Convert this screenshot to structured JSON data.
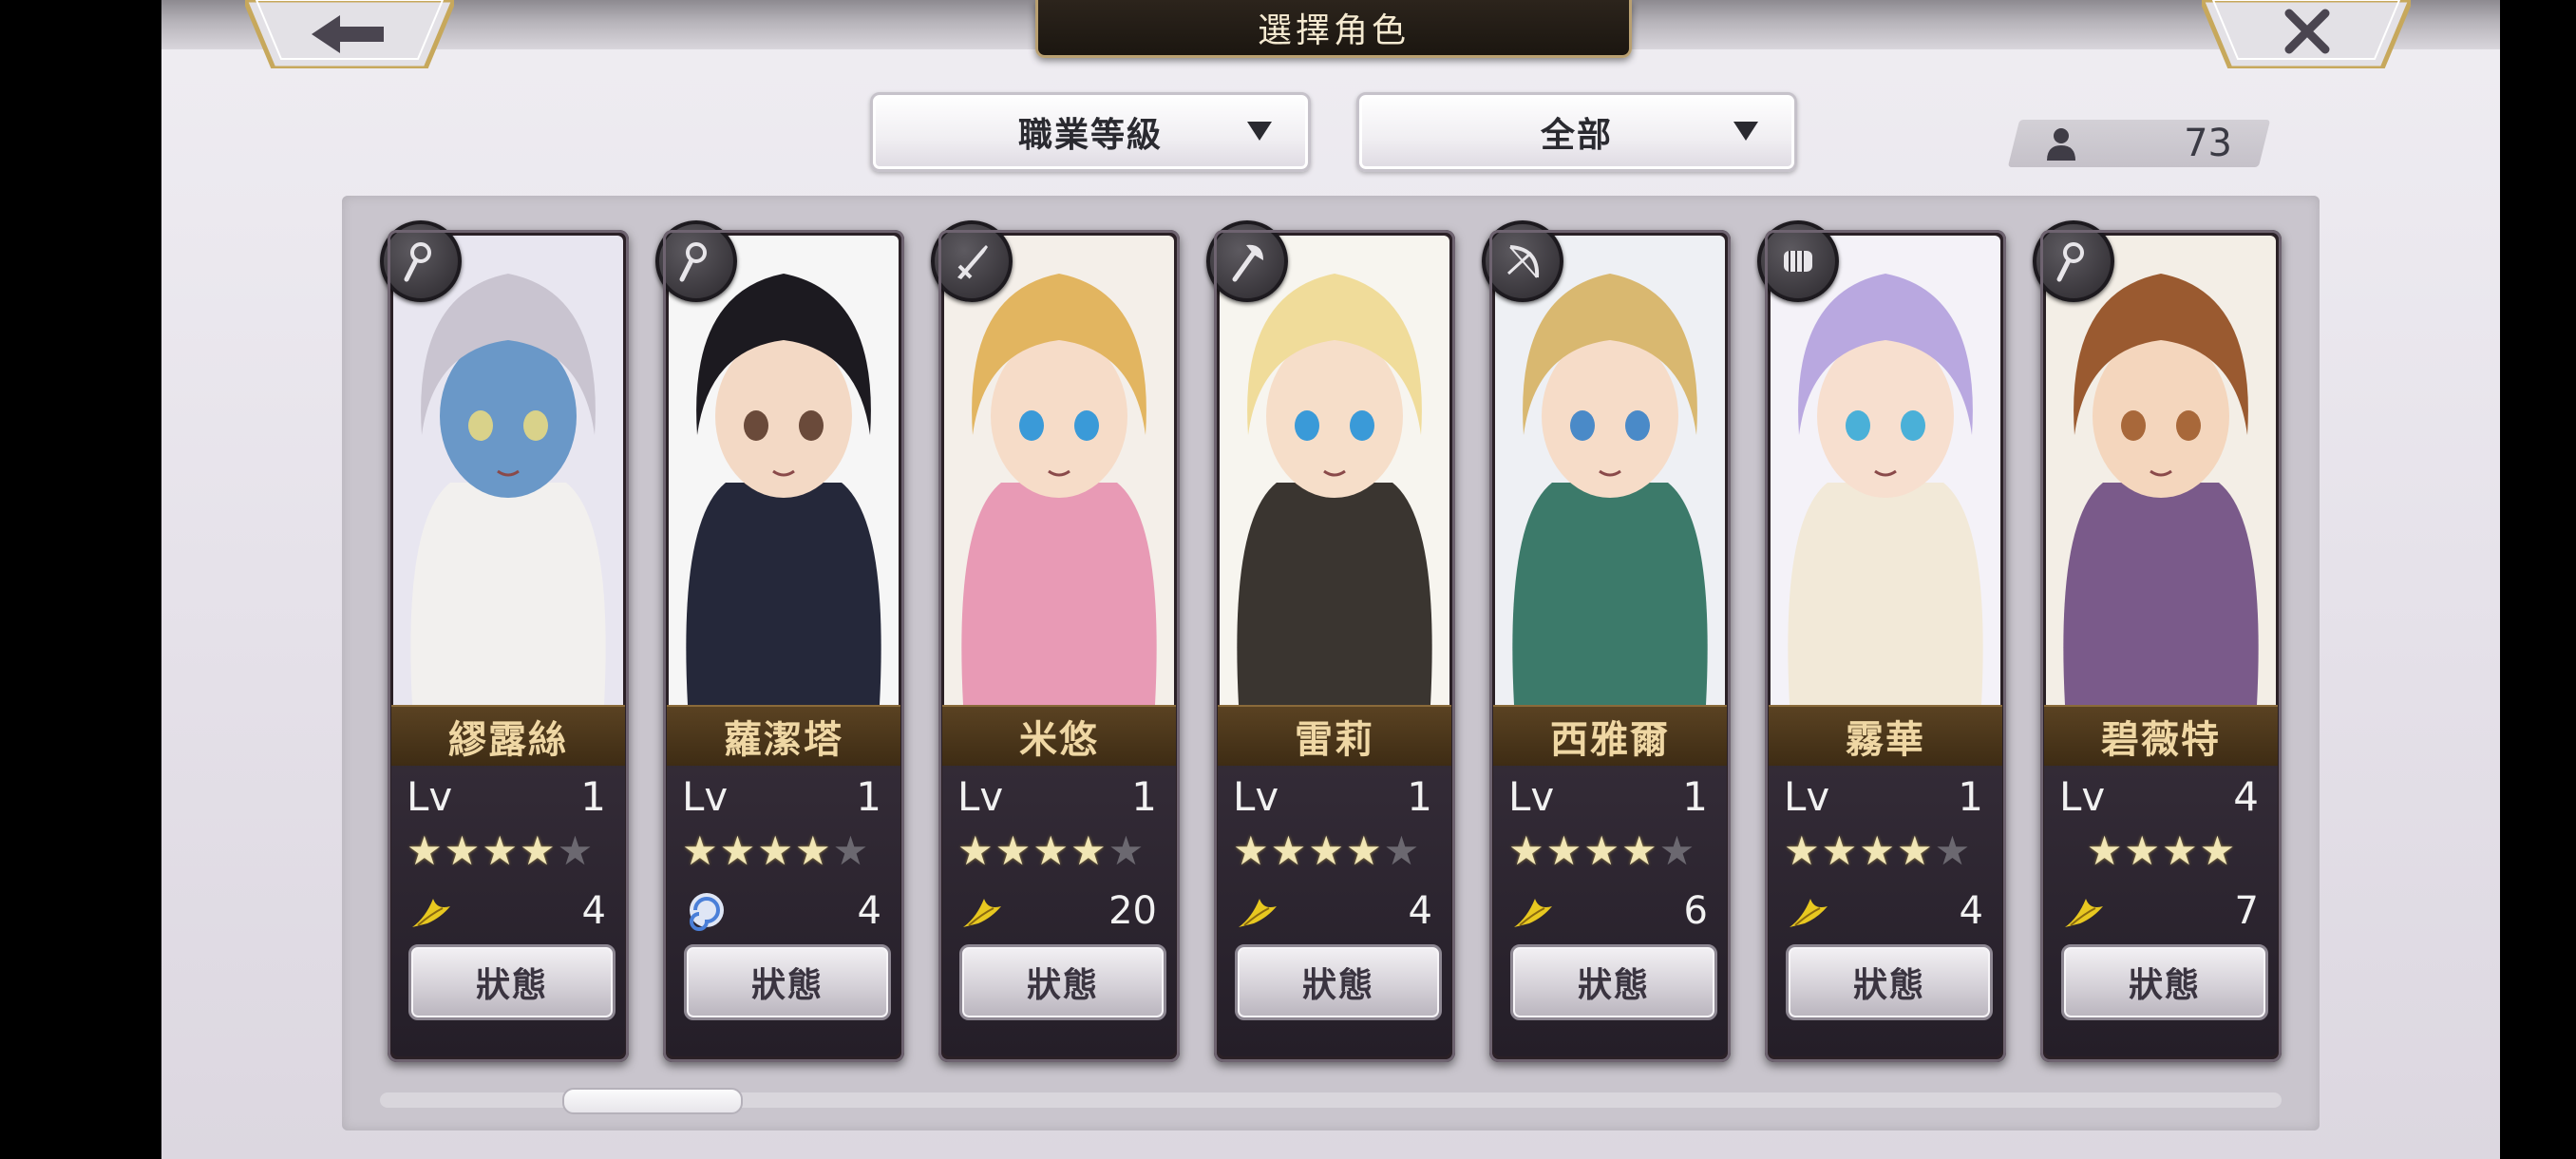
{
  "header": {
    "title": "選擇角色",
    "back_icon": "back-arrow-icon",
    "close_icon": "close-x-icon"
  },
  "filters": {
    "class_sort_label": "職業等級",
    "category_label": "全部"
  },
  "character_count": "73",
  "status_button_label": "狀態",
  "lv_label": "Lv",
  "characters": [
    {
      "name": "繆露絲",
      "level": "1",
      "stars": 4,
      "max_stars": 5,
      "class_icon": "staff-icon",
      "element_icon": "wind-feather-icon",
      "element_value": "4"
    },
    {
      "name": "蘿潔塔",
      "level": "1",
      "stars": 4,
      "max_stars": 5,
      "class_icon": "staff-icon",
      "element_icon": "swirl-icon",
      "element_value": "4"
    },
    {
      "name": "米悠",
      "level": "1",
      "stars": 4,
      "max_stars": 5,
      "class_icon": "sword-icon",
      "element_icon": "wind-feather-icon",
      "element_value": "20"
    },
    {
      "name": "雷莉",
      "level": "1",
      "stars": 4,
      "max_stars": 5,
      "class_icon": "axe-icon",
      "element_icon": "wind-feather-icon",
      "element_value": "4"
    },
    {
      "name": "西雅爾",
      "level": "1",
      "stars": 4,
      "max_stars": 5,
      "class_icon": "bow-icon",
      "element_icon": "wind-feather-icon",
      "element_value": "6"
    },
    {
      "name": "霧華",
      "level": "1",
      "stars": 4,
      "max_stars": 5,
      "class_icon": "fist-icon",
      "element_icon": "wind-feather-icon",
      "element_value": "4"
    },
    {
      "name": "碧薇特",
      "level": "4",
      "stars": 4,
      "max_stars": 4,
      "class_icon": "staff-icon",
      "element_icon": "wind-feather-icon",
      "element_value": "7"
    }
  ],
  "colors": {
    "name_text": "#efd7a4",
    "star_on": "#f1e6b5",
    "star_off": "#6b6870",
    "element_wind": "#e8c820",
    "element_swirl": "#4a7fd8"
  },
  "scroll_position": 0.1
}
